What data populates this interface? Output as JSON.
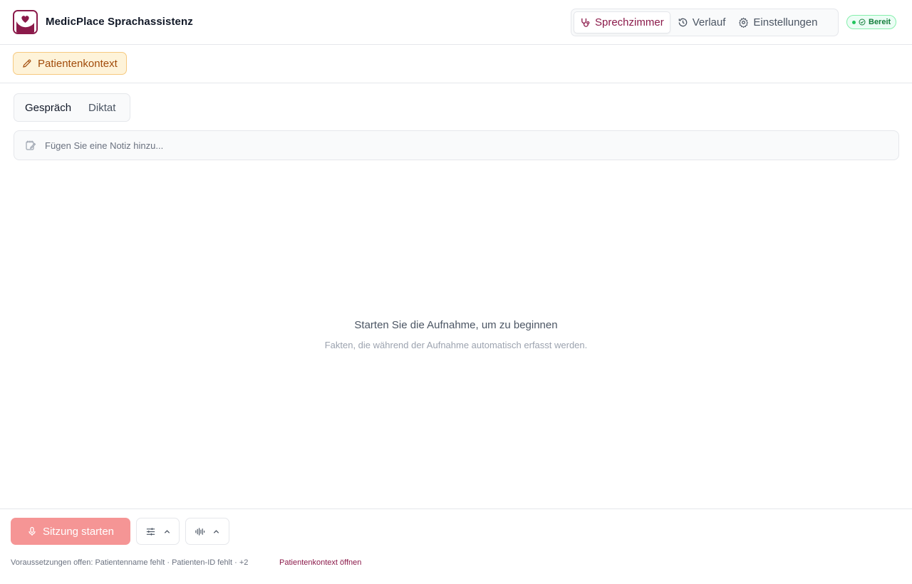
{
  "app": {
    "title": "MedicPlace Sprachassistenz",
    "logo_icon": "heart-hands-logo",
    "brand_color": "#8b1a4a"
  },
  "nav": {
    "items": [
      {
        "label": "Sprechzimmer",
        "icon": "stethoscope-icon",
        "active": true
      },
      {
        "label": "Verlauf",
        "icon": "history-icon",
        "active": false
      },
      {
        "label": "Einstellungen",
        "icon": "gear-icon",
        "active": false
      }
    ]
  },
  "status": {
    "label": "Bereit",
    "color": "#15803d"
  },
  "context": {
    "button_label": "Patientenkontext",
    "icon": "pencil-icon"
  },
  "modes": {
    "items": [
      {
        "label": "Gespräch",
        "active": true
      },
      {
        "label": "Diktat",
        "active": false
      }
    ]
  },
  "note": {
    "placeholder": "Fügen Sie eine Notiz hinzu...",
    "value": "",
    "icon": "note-edit-icon"
  },
  "empty_state": {
    "title": "Starten Sie die Aufnahme, um zu beginnen",
    "subtitle": "Fakten, die während der Aufnahme automatisch erfasst werden."
  },
  "footer": {
    "start_label": "Sitzung starten",
    "start_icon": "microphone-icon",
    "settings_icon": "sliders-icon",
    "audio_icon": "waveform-icon",
    "prerequisites": "Voraussetzungen offen: Patientenname fehlt · Patienten-ID fehlt · +2",
    "context_link": "Patientenkontext öffnen"
  }
}
